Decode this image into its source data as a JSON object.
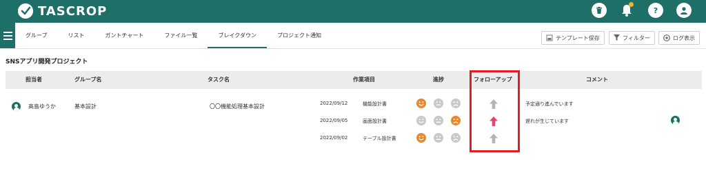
{
  "header": {
    "logo_text": "TASCROP",
    "icons": [
      "trash-icon",
      "bell-icon",
      "help-icon",
      "user-icon"
    ],
    "brand_color": "#1d6f68",
    "notification_dot_color": "#f5b225"
  },
  "nav": {
    "tabs": [
      {
        "label": "グループ"
      },
      {
        "label": "リスト"
      },
      {
        "label": "ガントチャート"
      },
      {
        "label": "ファイル一覧"
      },
      {
        "label": "ブレイクダウン",
        "active": true
      },
      {
        "label": "プロジェクト通知"
      }
    ],
    "buttons": {
      "template_save": "テンプレート保存",
      "filter": "フィルター",
      "log": "ログ表示"
    }
  },
  "project": {
    "title": "SNSアプリ開発プロジェクト"
  },
  "table": {
    "headers": {
      "assignee": "担当者",
      "group": "グループ名",
      "task": "タスク名",
      "work_item": "作業項目",
      "progress": "進捗",
      "follow_up": "フォローアップ",
      "comment": "コメント"
    },
    "row": {
      "assignee": "高島ゆうか",
      "group": "基本設計",
      "task": "〇〇機能処理基本設計",
      "items": [
        {
          "date": "2022/09/12",
          "name": "機能設計書",
          "progress": "happy",
          "follow_up": "normal",
          "comment": "予定通り進んでいます"
        },
        {
          "date": "2022/09/05",
          "name": "画面設計書",
          "progress": "sad",
          "follow_up": "alert",
          "comment": "遅れが生じています"
        },
        {
          "date": "2022/09/02",
          "name": "テーブル設計書",
          "progress": "happy",
          "follow_up": "normal",
          "comment": ""
        }
      ]
    },
    "face_colors": {
      "active": "#e68a2e",
      "inactive": "#c9c9c9"
    },
    "arrow_colors": {
      "normal": "#b5b5b5",
      "alert": "#e6446a"
    },
    "highlight_color": "#e01c24"
  }
}
